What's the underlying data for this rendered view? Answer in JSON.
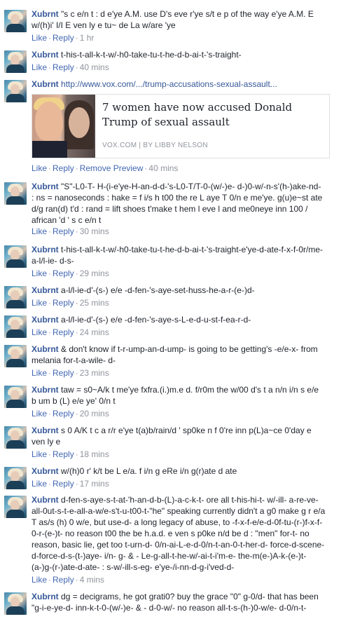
{
  "actions": {
    "like": "Like",
    "reply": "Reply",
    "remove_preview": "Remove Preview",
    "sep": "·"
  },
  "comments": [
    {
      "author": "Xubrnt",
      "text": "\"s c e/n t : d e'ye A.M. use D's eve r'ye s/t e p of the way e'ye A.M. E w/(h)i' I/I E ven ly e tu~ de La w/are 'ye",
      "time": "1 hr"
    },
    {
      "author": "Xubrnt",
      "text": "t-his-t-all-k-t-w/-h0-take-tu-t-he-d-b-ai-t-'s-traight-",
      "time": "40 mins"
    },
    {
      "author": "Xubrnt",
      "text": "http://www.vox.com/.../trump-accusations-sexual-assault...",
      "time": "40 mins",
      "preview": {
        "title": "7 women have now accused Donald Trump of sexual assault",
        "source": "VOX.COM | BY LIBBY NELSON"
      }
    },
    {
      "author": "Xubrnt",
      "text": "\"S\"-L0-T- H-(i-e'ye-H-an-d-d-'s-L0-T/T-0-(w/-)e- d-)0-w/-n-s'(h-)ake-nd- : ns = nanoseconds : hake = f i/s h t00 the re L aye T 0/n e me'ye. g(u)e~st ate d/g ran(d) t'd : rand = lift shoes t'make t hem l eve l and me0neye inn 100 / african 'd ' s c e/n t",
      "time": "30 mins"
    },
    {
      "author": "Xubrnt",
      "text": "t-his-t-all-k-t-w/-h0-take-tu-t-he-d-b-ai-t-'s-traight-e'ye-d-ate-f-x-f-0r/me-a-l/l-ie- d-s-",
      "time": "29 mins"
    },
    {
      "author": "Xubrnt",
      "text": "a-l/l-ie-d'-(s-) e/e -d-fen-'s-aye-set-huss-he-a-r-(e-)d-",
      "time": "25 mins"
    },
    {
      "author": "Xubrnt",
      "text": "a-l/l-ie-d'-(s-) e/e -d-fen-'s-aye-s-L-e-d-u-st-f-ea-r-d-",
      "time": "24 mins"
    },
    {
      "author": "Xubrnt",
      "text": "& don't know if t-r-ump-an-d-ump- is going to be getting's -e/e-x- from melania for-t-a-wile- d-",
      "time": "23 mins"
    },
    {
      "author": "Xubrnt",
      "text": "taw = s0~A/k t me'ye fxfra.(i.)m.e d. f/r0m the w/00 d's t a n/n i/n s e/e b um b (L) e/e ye' 0/n t",
      "time": "20 mins"
    },
    {
      "author": "Xubrnt",
      "text": "s 0 A/K t c a r/r e'ye t(a)b/rain/d ' sp0ke n f 0're inn p(L)a~ce 0'day e ven ly e",
      "time": "18 mins"
    },
    {
      "author": "Xubrnt",
      "text": "w/(h)0 r' k/t be L e/a. f i/n g eRe i/n g(r)ate d ate",
      "time": "17 mins"
    },
    {
      "author": "Xubrnt",
      "text": "d-fen-s-aye-s-t-at-'h-an-d-b-(L)-a-c-k-t- ore all t-his-hi-t- w/-ill- a-re-ve-all-0ut-s-t-e-all-a-w/e-s't-u-t00-t-\"he\" speaking currently didn't a g0 make g r e/a T as/s (h) 0 w/e, but use-d- a long legacy of abuse, to -f-x-f-e/e-d-0f-tu-(r-)f-x-f-0-r-(e-)t- no reason t00 the be h.a.d. e ven s p0ke n/d be d : \"men\" for-t- no reason, basic lie, get too t-urn-d- 0/n-ai-L-e-d-0/n-t-an-0-t-her-d- force-d-scene-d-force-d-s-(t-)aye- i/n- g- & - Le-g-all-t-he-w/-ai-t-i'm-e- the-m(e-)A-k-(e-)t-(a-)g-(r-)ate-d-ate- : s-w/-ill-s-eg- e'ye-/i-nn-d-g-i'ved-d-",
      "time": "4 mins"
    },
    {
      "author": "Xubrnt",
      "text": "dg = decigrams, he got grati0? buy the grace \"0\" g-0/d- that has been \"g-i-e-ye-d- inn-k-t-0-(w/-)e- & - d-0-w/- no reason all-t-s-(h-)0-w/e- d-0/n-t-",
      "time": "2 mins"
    }
  ]
}
